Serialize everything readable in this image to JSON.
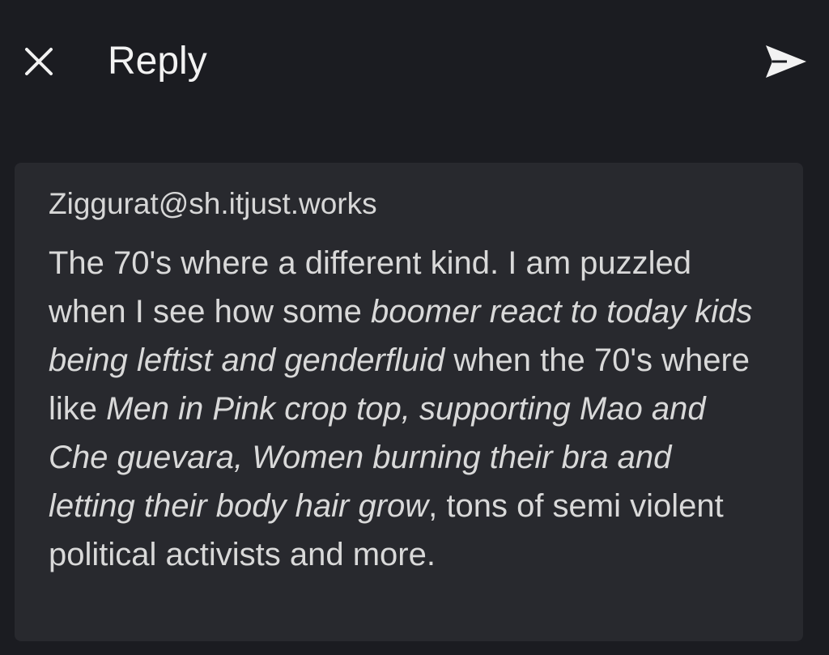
{
  "header": {
    "title": "Reply",
    "close_icon": "close-icon",
    "send_icon": "send-icon"
  },
  "quote": {
    "author": "Ziggurat@sh.itjust.works",
    "segments": [
      {
        "text": "The 70's where a different kind. I am puzzled when I see how some ",
        "italic": false
      },
      {
        "text": "boomer react to today kids being leftist and genderfluid",
        "italic": true
      },
      {
        "text": " when the 70's where like ",
        "italic": false
      },
      {
        "text": "Men in Pink crop top, supporting Mao and Che guevara, Women burning their bra and letting their body hair grow",
        "italic": true
      },
      {
        "text": ", tons of semi violent political activists and more.",
        "italic": false
      }
    ]
  },
  "colors": {
    "background": "#1b1c21",
    "card": "#28292e",
    "text": "#d9d9d9",
    "icon": "#f2f2f2"
  }
}
